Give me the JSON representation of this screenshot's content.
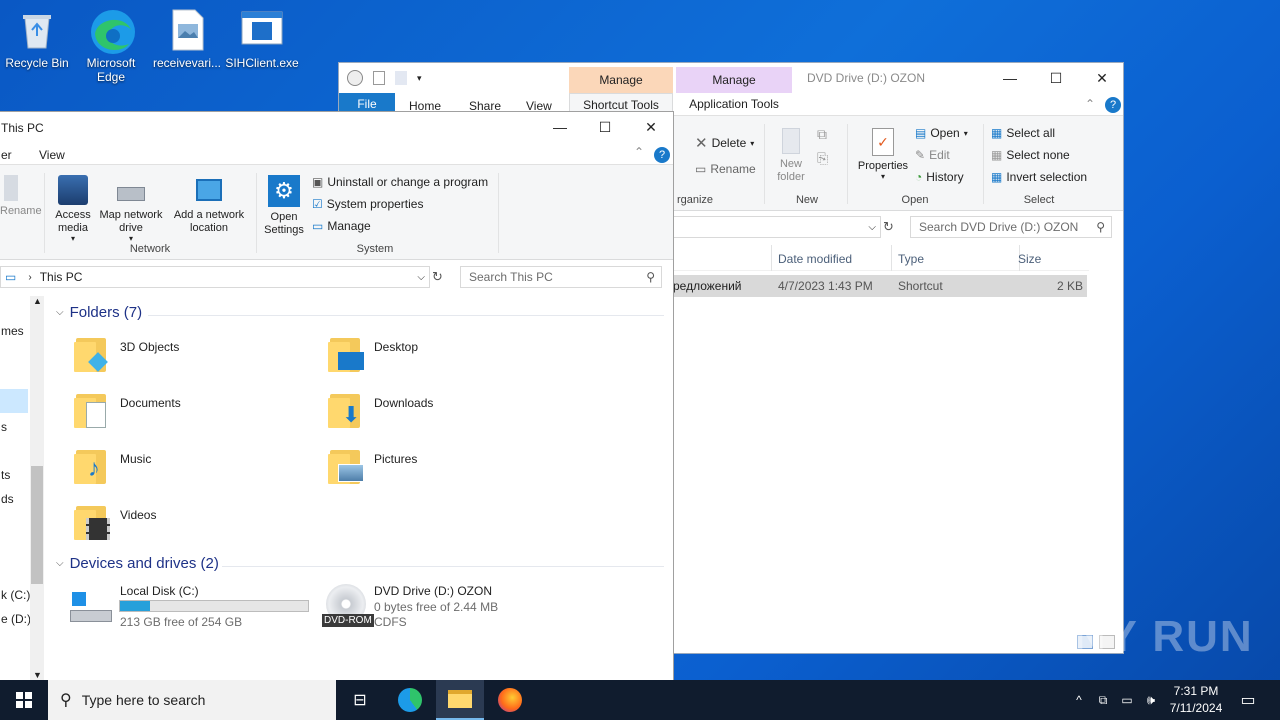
{
  "desktop": {
    "icons": [
      {
        "label": "Recycle Bin",
        "icon": "recycle-bin-icon"
      },
      {
        "label": "Microsoft Edge",
        "icon": "edge-icon"
      },
      {
        "label": "receivevari...",
        "icon": "file-icon"
      },
      {
        "label": "SIHClient.exe",
        "icon": "exe-icon"
      }
    ],
    "watermark": "ANY RUN"
  },
  "dvd_window": {
    "title": "DVD Drive (D:) OZON",
    "context_tabs": [
      {
        "group": "Manage",
        "label": "Shortcut Tools",
        "color": "#fbd7b9"
      },
      {
        "group": "Manage",
        "label": "Application Tools",
        "color": "#e9d3f7"
      }
    ],
    "tabs": [
      "File",
      "Home",
      "Share",
      "View"
    ],
    "ribbon": {
      "organize": {
        "delete": "Delete",
        "rename": "Rename",
        "group": "rganize"
      },
      "new": {
        "new_folder": "New folder",
        "group": "New"
      },
      "open": {
        "properties": "Properties",
        "open": "Open",
        "edit": "Edit",
        "history": "History",
        "group": "Open"
      },
      "select": {
        "select_all": "Select all",
        "select_none": "Select none",
        "invert": "Invert selection",
        "group": "Select"
      }
    },
    "search_placeholder": "Search DVD Drive (D:) OZON",
    "columns": [
      "Date modified",
      "Type",
      "Size"
    ],
    "row": {
      "name": "редложений",
      "date": "4/7/2023 1:43 PM",
      "type": "Shortcut",
      "size": "2 KB"
    }
  },
  "pc_window": {
    "title": "This PC",
    "tabs": [
      "er",
      "View"
    ],
    "ribbon": {
      "rename": "Rename",
      "network": {
        "access_media": "Access media",
        "map_drive": "Map network drive",
        "add_location": "Add a network location",
        "group": "Network"
      },
      "system": {
        "open_settings": "Open Settings",
        "uninstall": "Uninstall or change a program",
        "sys_props": "System properties",
        "manage": "Manage",
        "group": "System"
      }
    },
    "address": "This PC",
    "search_placeholder": "Search This PC",
    "nav_fragments": [
      "mes",
      "s",
      "ts",
      "ds",
      "k (C:)",
      "e (D:)"
    ],
    "folders_header": "Folders (7)",
    "folders": [
      "3D Objects",
      "Desktop",
      "Documents",
      "Downloads",
      "Music",
      "Pictures",
      "Videos"
    ],
    "devices_header": "Devices and drives (2)",
    "drives": [
      {
        "name": "Local Disk (C:)",
        "free": "213 GB free of 254 GB",
        "used_fraction": 0.16
      },
      {
        "name": "DVD Drive (D:) OZON",
        "free": "0 bytes free of 2.44 MB",
        "fs": "CDFS",
        "badge": "DVD-ROM"
      }
    ]
  },
  "taskbar": {
    "search_placeholder": "Type here to search",
    "time": "7:31 PM",
    "date": "7/11/2024"
  }
}
